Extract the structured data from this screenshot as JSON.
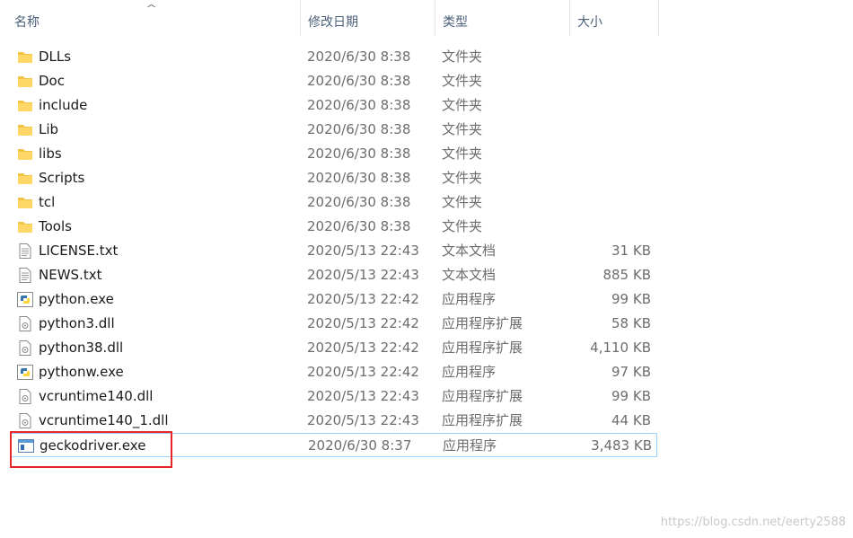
{
  "header": {
    "name": "名称",
    "date": "修改日期",
    "type": "类型",
    "size": "大小"
  },
  "files": [
    {
      "name": "DLLs",
      "date": "2020/6/30 8:38",
      "type": "文件夹",
      "size": "",
      "icon": "folder-icon"
    },
    {
      "name": "Doc",
      "date": "2020/6/30 8:38",
      "type": "文件夹",
      "size": "",
      "icon": "folder-icon"
    },
    {
      "name": "include",
      "date": "2020/6/30 8:38",
      "type": "文件夹",
      "size": "",
      "icon": "folder-icon"
    },
    {
      "name": "Lib",
      "date": "2020/6/30 8:38",
      "type": "文件夹",
      "size": "",
      "icon": "folder-icon"
    },
    {
      "name": "libs",
      "date": "2020/6/30 8:38",
      "type": "文件夹",
      "size": "",
      "icon": "folder-icon"
    },
    {
      "name": "Scripts",
      "date": "2020/6/30 8:38",
      "type": "文件夹",
      "size": "",
      "icon": "folder-icon"
    },
    {
      "name": "tcl",
      "date": "2020/6/30 8:38",
      "type": "文件夹",
      "size": "",
      "icon": "folder-icon"
    },
    {
      "name": "Tools",
      "date": "2020/6/30 8:38",
      "type": "文件夹",
      "size": "",
      "icon": "folder-icon"
    },
    {
      "name": "LICENSE.txt",
      "date": "2020/5/13 22:43",
      "type": "文本文档",
      "size": "31 KB",
      "icon": "text-file-icon"
    },
    {
      "name": "NEWS.txt",
      "date": "2020/5/13 22:43",
      "type": "文本文档",
      "size": "885 KB",
      "icon": "text-file-icon"
    },
    {
      "name": "python.exe",
      "date": "2020/5/13 22:42",
      "type": "应用程序",
      "size": "99 KB",
      "icon": "python-exe-icon"
    },
    {
      "name": "python3.dll",
      "date": "2020/5/13 22:42",
      "type": "应用程序扩展",
      "size": "58 KB",
      "icon": "dll-file-icon"
    },
    {
      "name": "python38.dll",
      "date": "2020/5/13 22:42",
      "type": "应用程序扩展",
      "size": "4,110 KB",
      "icon": "dll-file-icon"
    },
    {
      "name": "pythonw.exe",
      "date": "2020/5/13 22:42",
      "type": "应用程序",
      "size": "97 KB",
      "icon": "python-exe-icon"
    },
    {
      "name": "vcruntime140.dll",
      "date": "2020/5/13 22:43",
      "type": "应用程序扩展",
      "size": "99 KB",
      "icon": "dll-file-icon"
    },
    {
      "name": "vcruntime140_1.dll",
      "date": "2020/5/13 22:43",
      "type": "应用程序扩展",
      "size": "44 KB",
      "icon": "dll-file-icon"
    },
    {
      "name": "geckodriver.exe",
      "date": "2020/6/30 8:37",
      "type": "应用程序",
      "size": "3,483 KB",
      "icon": "application-icon",
      "selected": true
    }
  ],
  "watermark": "https://blog.csdn.net/eerty2588",
  "colors": {
    "highlight_border": "#e8262a",
    "selection_border": "#99d1ff",
    "folder": "#f3c344"
  }
}
